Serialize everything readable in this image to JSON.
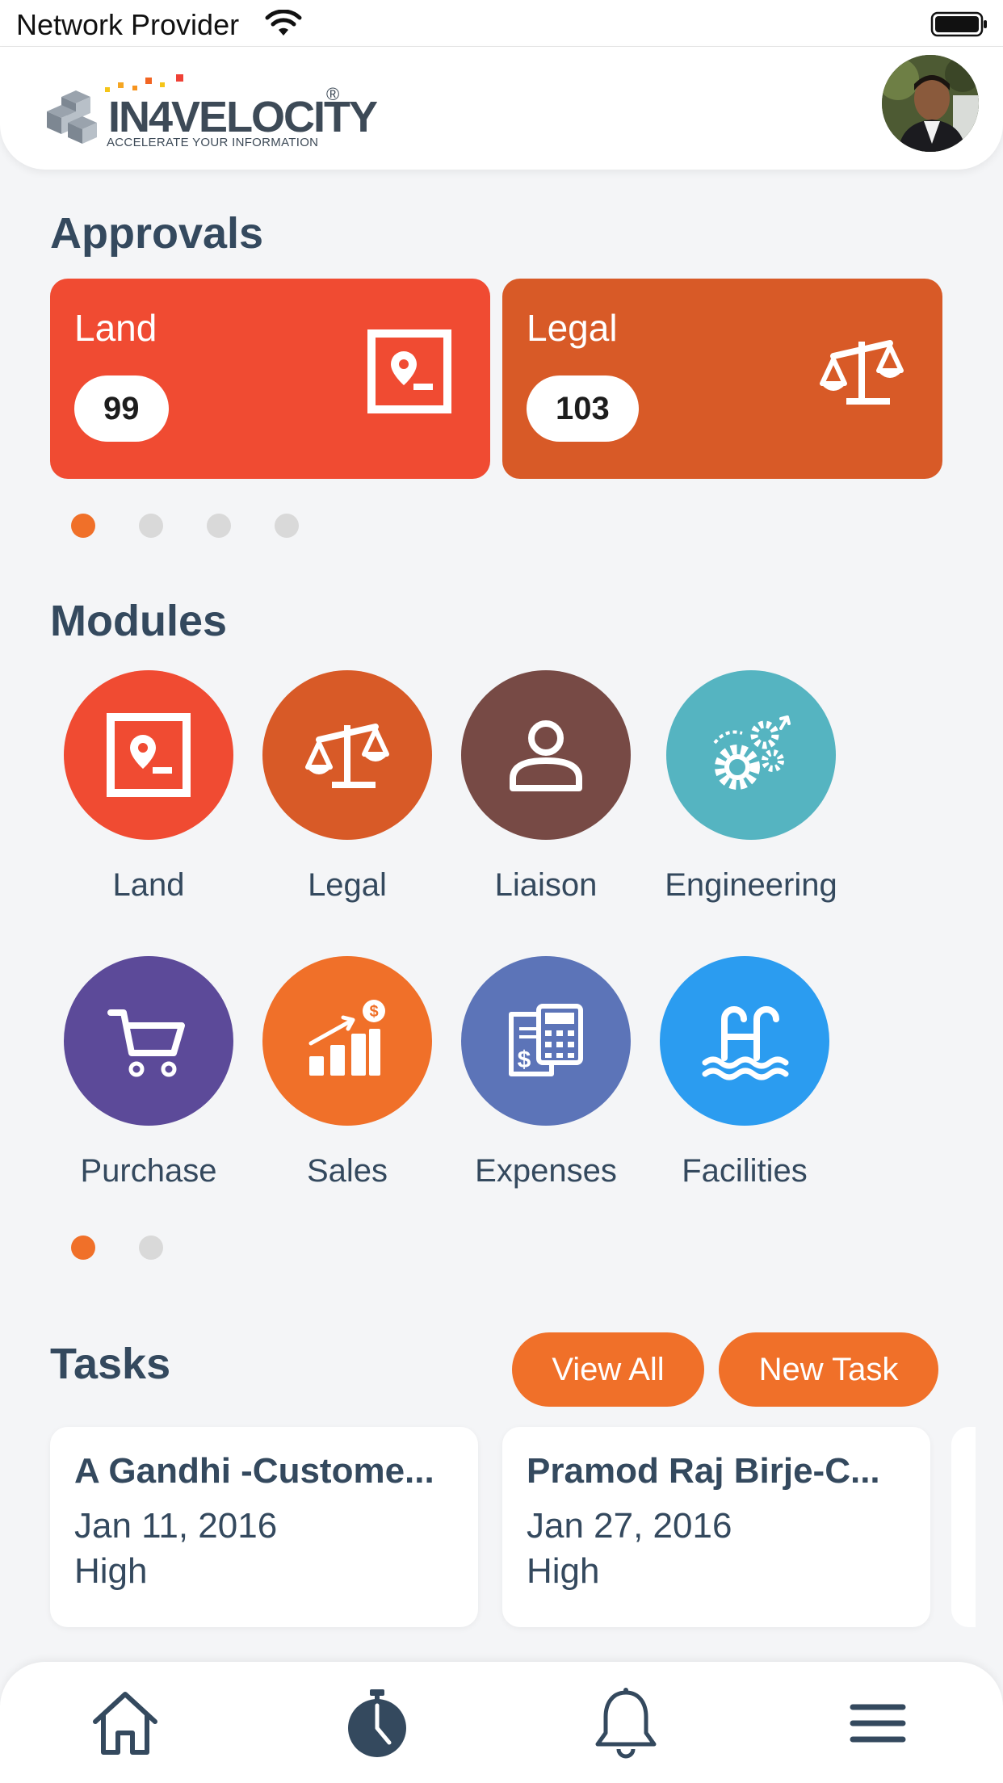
{
  "status_bar": {
    "carrier": "Network Provider"
  },
  "header": {
    "logo_name": "IN4VELOCITY",
    "logo_registered": "®",
    "logo_tagline": "ACCELERATE YOUR INFORMATION"
  },
  "approvals": {
    "title": "Approvals",
    "cards": [
      {
        "label": "Land",
        "count": "99",
        "color": "#f04b32",
        "icon": "map-pin-frame-icon"
      },
      {
        "label": "Legal",
        "count": "103",
        "color": "#d85a27",
        "icon": "scales-icon"
      }
    ],
    "page_count": 4,
    "active_page": 0
  },
  "modules": {
    "title": "Modules",
    "items": [
      {
        "label": "Land",
        "color": "#f04b32",
        "icon": "map-pin-frame-icon"
      },
      {
        "label": "Legal",
        "color": "#d85a27",
        "icon": "scales-icon"
      },
      {
        "label": "Liaison",
        "color": "#774a45",
        "icon": "person-icon"
      },
      {
        "label": "Engineering",
        "color": "#55b4c1",
        "icon": "gears-icon"
      },
      {
        "label": "Purchase",
        "color": "#5c4a99",
        "icon": "shopping-cart-icon"
      },
      {
        "label": "Sales",
        "color": "#f07029",
        "icon": "sales-chart-icon"
      },
      {
        "label": "Expenses",
        "color": "#5c74b8",
        "icon": "expenses-calculator-icon"
      },
      {
        "label": "Facilities",
        "color": "#2b9cf0",
        "icon": "pool-icon"
      }
    ],
    "page_count": 2,
    "active_page": 0
  },
  "tasks": {
    "title": "Tasks",
    "view_all_label": "View All",
    "new_task_label": "New Task",
    "items": [
      {
        "title": "A Gandhi -Custome...",
        "date": "Jan 11, 2016",
        "priority": "High"
      },
      {
        "title": "Pramod Raj Birje-C...",
        "date": "Jan 27, 2016",
        "priority": "High"
      }
    ]
  },
  "bottom_nav": {
    "items": [
      "home-icon",
      "stopwatch-icon",
      "bell-icon",
      "menu-icon"
    ]
  },
  "colors": {
    "accent": "#f07029",
    "text_dark": "#34495e",
    "background": "#f4f5f7"
  }
}
